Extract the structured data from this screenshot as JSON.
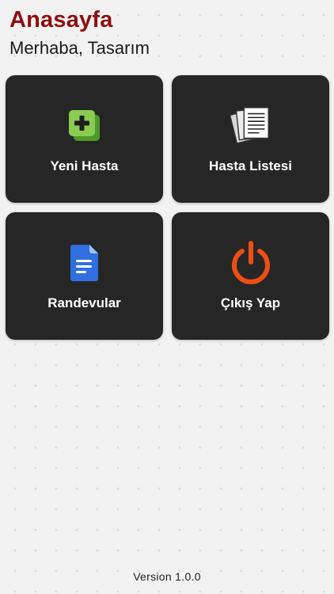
{
  "header": {
    "title": "Anasayfa",
    "greeting": "Merhaba, Tasarım"
  },
  "tiles": [
    {
      "label": "Yeni Hasta",
      "icon": "add-patient-icon"
    },
    {
      "label": "Hasta Listesi",
      "icon": "documents-stack-icon"
    },
    {
      "label": "Randevular",
      "icon": "document-icon"
    },
    {
      "label": "Çıkış Yap",
      "icon": "power-icon"
    }
  ],
  "footer": {
    "version": "Version 1.0.0"
  },
  "colors": {
    "title": "#8f0f0f",
    "background": "#f2f2f2",
    "tile": "#262626",
    "add_icon": "#7bc044",
    "document_icon": "#2f6fe0",
    "power_icon": "#ee4e15"
  }
}
